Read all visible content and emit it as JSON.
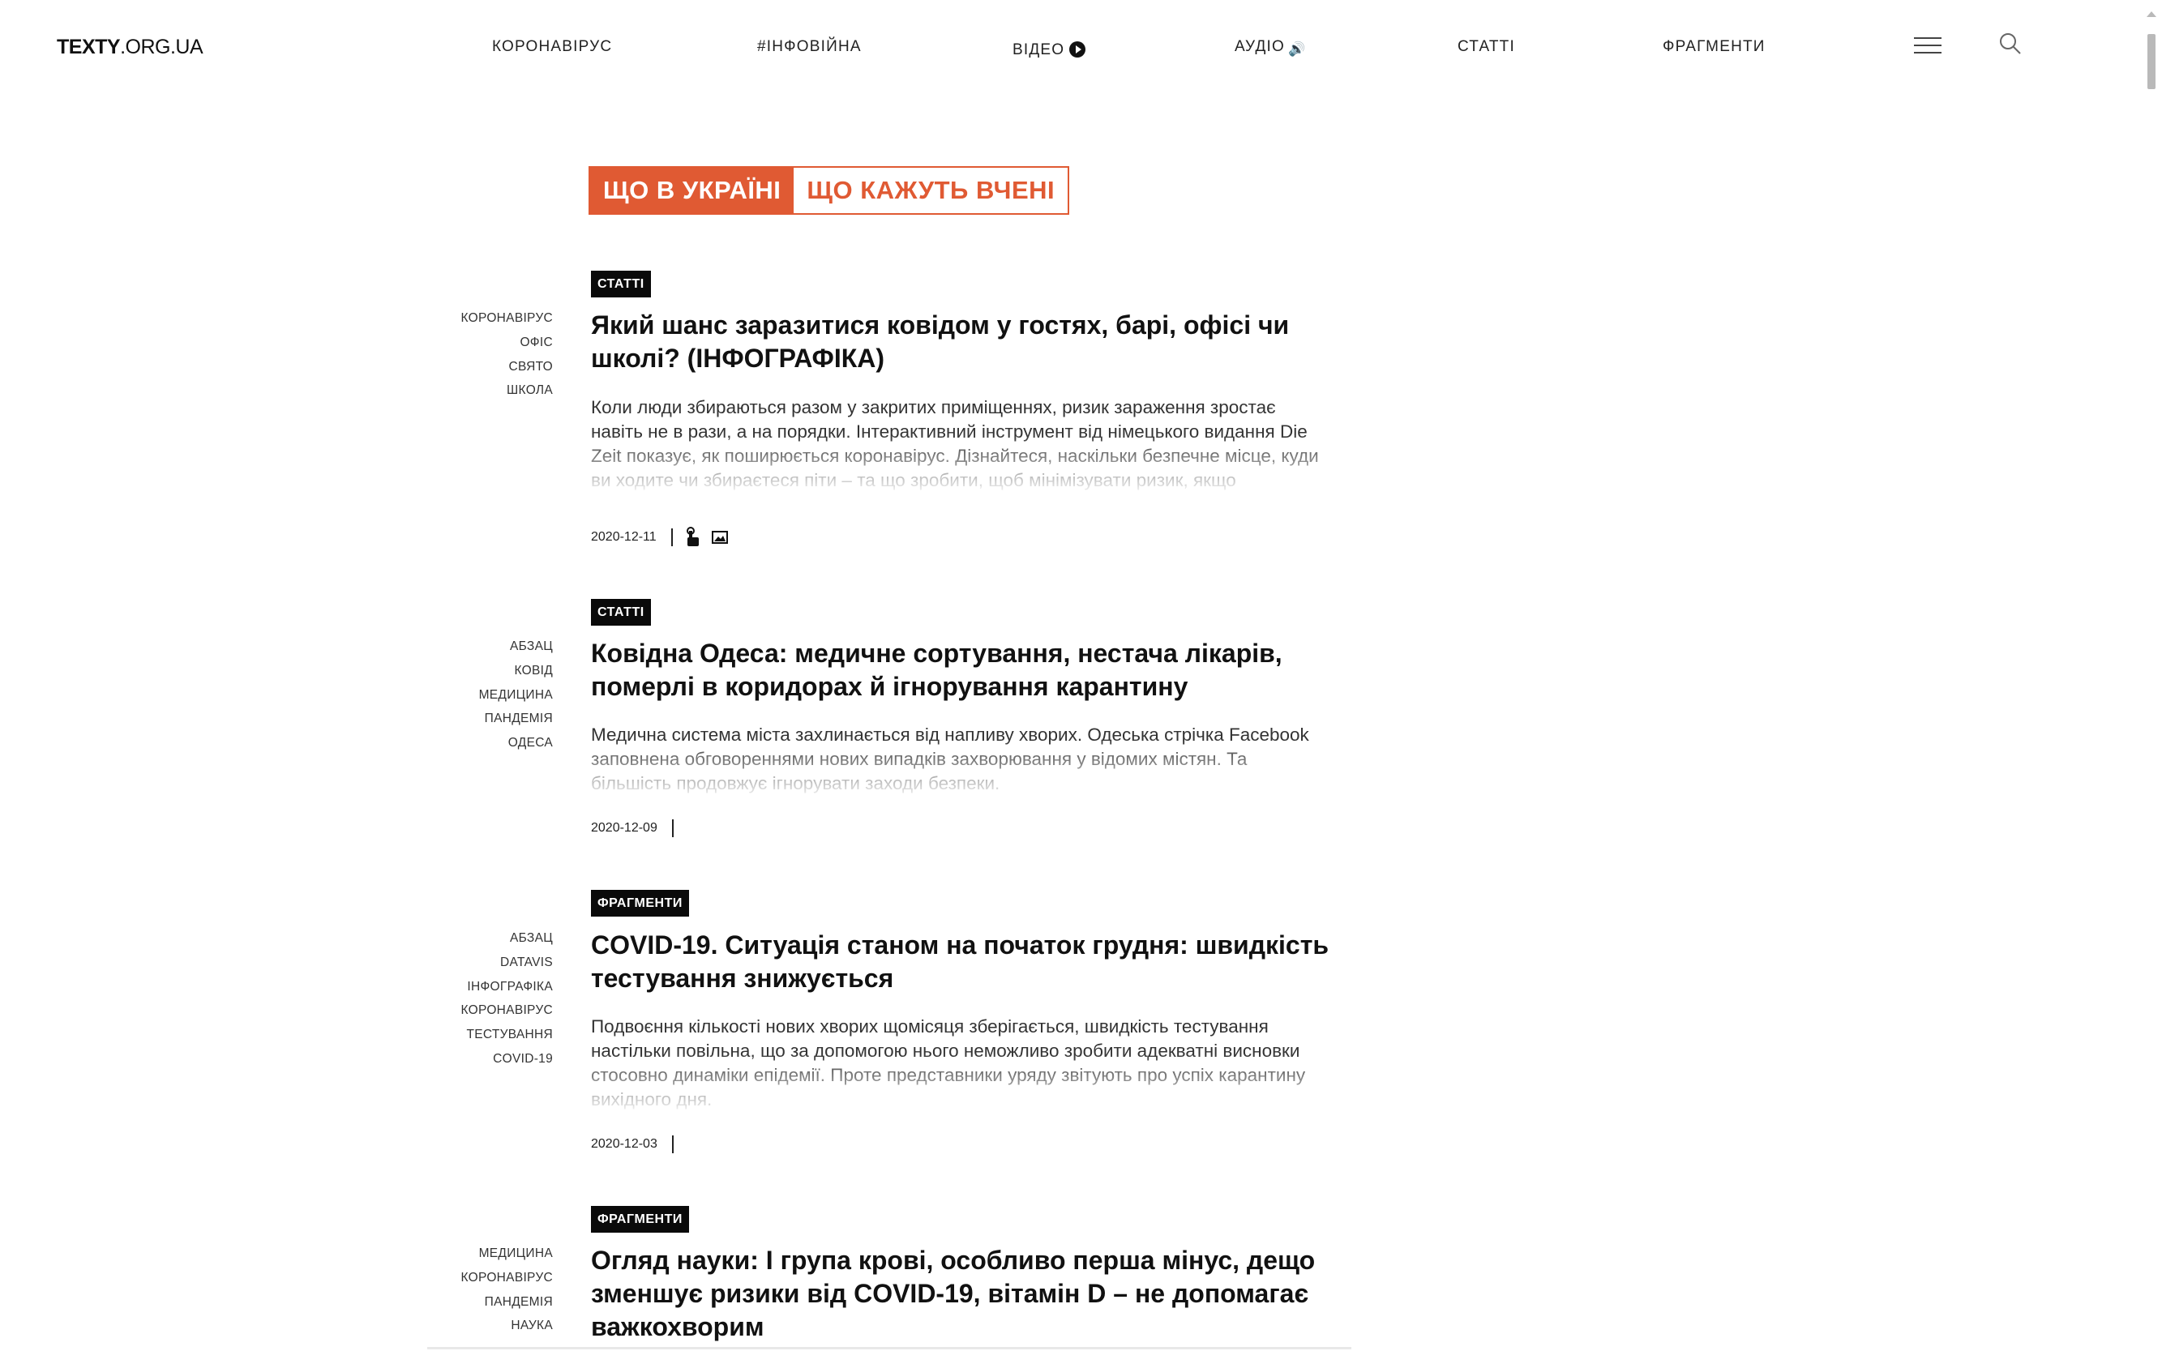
{
  "header": {
    "logo_bold": "TEXTY",
    "logo_rest": ".ORG.UA",
    "nav": [
      {
        "label": "КОРОНАВІРУС"
      },
      {
        "label": "#ІНФОВІЙНА"
      },
      {
        "label": "ВІДЕО",
        "icon": "play-icon"
      },
      {
        "label": "АУДІО",
        "icon": "speaker-icon"
      },
      {
        "label": "СТАТТІ"
      },
      {
        "label": "ФРАГМЕНТИ"
      }
    ]
  },
  "tabs": [
    {
      "label": "ЩО В УКРАЇНІ",
      "active": true
    },
    {
      "label": "ЩО КАЖУТЬ ВЧЕНІ",
      "active": false
    }
  ],
  "colors": {
    "accent": "#e05a33",
    "badge": "#0a0a0a"
  },
  "articles": [
    {
      "category": "СТАТТІ",
      "tags": [
        "КОРОНАВІРУС",
        "ОФІС",
        "СВЯТО",
        "ШКОЛА"
      ],
      "title": "Який шанс заразитися ковідом у гостях, барі, офісі чи школі? (ІНФОГРАФІКА)",
      "excerpt": "Коли люди збираються разом у закритих приміщеннях, ризик зараження зростає навіть не в рази, а на порядки. Інтерактивний інструмент від німецького видання Die Zeit показує, як поширюється коронавірус. Дізнайтеся, наскільки безпечне місце, куди ви ходите чи збираєтеся піти – та що зробити, щоб мінімізувати ризик, якщо",
      "date": "2020-12-11",
      "icons": [
        "touch-icon",
        "image-icon"
      ]
    },
    {
      "category": "СТАТТІ",
      "tags": [
        "АБЗАЦ",
        "КОВІД",
        "МЕДИЦИНА",
        "ПАНДЕМІЯ",
        "ОДЕСА"
      ],
      "title": "Ковідна Одеса: медичне сортування, нестача лікарів, померлі в коридорах й ігнорування карантину",
      "excerpt": "Медична система міста захлинається від напливу хворих. Одеська стрічка Facebook заповнена обговореннями нових випадків захворювання у відомих містян. Та більшість продовжує ігнорувати заходи безпеки.",
      "date": "2020-12-09",
      "icons": []
    },
    {
      "category": "ФРАГМЕНТИ",
      "tags": [
        "АБЗАЦ",
        "DATAVIS",
        "ІНФОГРАФІКА",
        "КОРОНАВІРУС",
        "ТЕСТУВАННЯ",
        "COVID-19"
      ],
      "title": "COVID-19. Ситуація станом на початок грудня: швидкість тестування знижується",
      "excerpt": "Подвоєння кількості нових хворих щомісяця зберігається, швидкість тестування настільки повільна, що за допомогою нього неможливо зробити адекватні висновки стосовно динаміки епідемії. Проте представники уряду звітують про успіх карантину вихідного дня.",
      "date": "2020-12-03",
      "icons": []
    },
    {
      "category": "ФРАГМЕНТИ",
      "tags": [
        "МЕДИЦИНА",
        "КОРОНАВІРУС",
        "ПАНДЕМІЯ",
        "НАУКА"
      ],
      "title": "Огляд науки: I група крові, особливо перша мінус, дещо зменшує ризики від COVID-19, вітамін D – не допомагає важкохворим",
      "excerpt": "",
      "date": "",
      "icons": []
    }
  ]
}
